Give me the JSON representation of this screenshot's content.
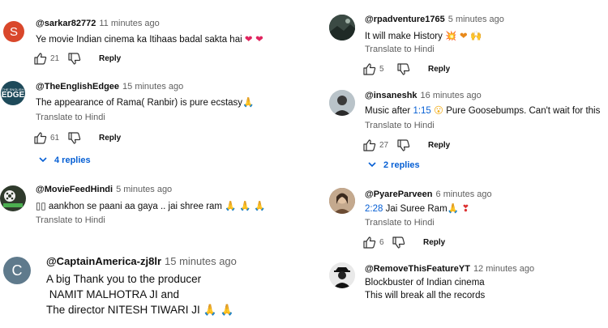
{
  "left": {
    "comments": [
      {
        "handle": "@sarkar82772",
        "time": "11 minutes ago",
        "avatar_letter": "S",
        "avatar_color": "#d9472b",
        "text": "Ye movie Indian cinema ka Itihaas badal sakta hai",
        "emoji": "❤ ❤",
        "likes": "21",
        "reply_label": "Reply"
      },
      {
        "handle": "@TheEnglishEdgee",
        "time": "15 minutes ago",
        "avatar_label": "EDGE",
        "text": "The appearance of Rama( Ranbir) is pure ecstasy",
        "emoji": "🙏",
        "translate": "Translate to Hindi",
        "likes": "61",
        "reply_label": "Reply",
        "replies_label": "4 replies"
      },
      {
        "handle": "@MovieFeedHindi",
        "time": "5 minutes ago",
        "text": "▯▯ aankhon se paani aa gaya .. jai shree ram",
        "emoji": "🙏 🙏 🙏",
        "translate": "Translate to Hindi"
      },
      {
        "handle": "@CaptainAmerica-zj8lr",
        "time": "15 minutes ago",
        "avatar_letter": "C",
        "avatar_color": "#5f7a8c",
        "lines": [
          "A big Thank you to the producer",
          " NAMIT MALHOTRA JI and",
          "The director NITESH TIWARI JI"
        ],
        "emoji": "🙏 🙏"
      }
    ]
  },
  "right": {
    "comments": [
      {
        "handle": "@rpadventure1765",
        "time": "5 minutes ago",
        "text": "It will make History",
        "emoji": "💥 ❤ 🙌",
        "translate": "Translate to Hindi",
        "likes": "5",
        "reply_label": "Reply"
      },
      {
        "handle": "@insaneshk",
        "time": "16 minutes ago",
        "text_before": "Music after ",
        "timestamp": "1:15",
        "text_after": " Pure Goosebumps. Can't wait for this",
        "emoji": "😮",
        "translate": "Translate to Hindi",
        "likes": "27",
        "reply_label": "Reply",
        "replies_label": "2 replies"
      },
      {
        "handle": "@PyareParveen",
        "time": "6 minutes ago",
        "timestamp": "2:28",
        "text_after": " Jai Suree Ram",
        "emoji": "🙏 ❣",
        "translate": "Translate to Hindi",
        "likes": "6",
        "reply_label": "Reply"
      },
      {
        "handle": "@RemoveThisFeatureYT",
        "time": "12 minutes ago",
        "lines": [
          "Blockbuster of Indian cinema",
          "This will break all the records"
        ]
      }
    ]
  },
  "colors": {
    "link_blue": "#065fd4",
    "secondary_text": "#606060",
    "heart_red": "#e0245e"
  },
  "icons": [
    "like-icon",
    "dislike-icon",
    "chevron-down-icon"
  ]
}
